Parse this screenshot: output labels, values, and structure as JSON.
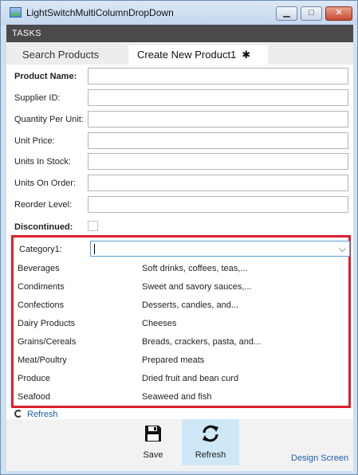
{
  "window": {
    "title": "LightSwitchMultiColumnDropDown",
    "min_glyph": "▁",
    "max_glyph": "□",
    "close_glyph": "✕"
  },
  "tasks_label": "TASKS",
  "tabs": [
    {
      "label": "Search Products"
    },
    {
      "label": "Create New Product1",
      "modified_marker": "✱"
    }
  ],
  "form": {
    "fields": [
      {
        "label": "Product Name:",
        "value": ""
      },
      {
        "label": "Supplier ID:",
        "value": ""
      },
      {
        "label": "Quantity Per Unit:",
        "value": ""
      },
      {
        "label": "Unit Price:",
        "value": ""
      },
      {
        "label": "Units In Stock:",
        "value": ""
      },
      {
        "label": "Units On Order:",
        "value": ""
      },
      {
        "label": "Reorder Level:",
        "value": ""
      }
    ],
    "discontinued_label": "Discontinued:",
    "discontinued_checked": false
  },
  "category": {
    "label": "Category1:",
    "value": "",
    "arrow_glyph": "⌵",
    "options": [
      {
        "name": "Beverages",
        "description": "Soft drinks, coffees, teas,..."
      },
      {
        "name": "Condiments",
        "description": "Sweet and savory sauces,..."
      },
      {
        "name": "Confections",
        "description": "Desserts, candies, and..."
      },
      {
        "name": "Dairy Products",
        "description": "Cheeses"
      },
      {
        "name": "Grains/Cereals",
        "description": "Breads, crackers, pasta, and..."
      },
      {
        "name": "Meat/Poultry",
        "description": "Prepared meats"
      },
      {
        "name": "Produce",
        "description": "Dried fruit and bean curd"
      },
      {
        "name": "Seafood",
        "description": "Seaweed and fish"
      }
    ]
  },
  "refresh_link": "Refresh",
  "commands": {
    "save_label": "Save",
    "refresh_label": "Refresh"
  },
  "design_screen": "Design Screen",
  "colors": {
    "highlight_border": "#d9202f",
    "tasks_bar": "#4a4a4a",
    "link": "#1c5fa8"
  }
}
